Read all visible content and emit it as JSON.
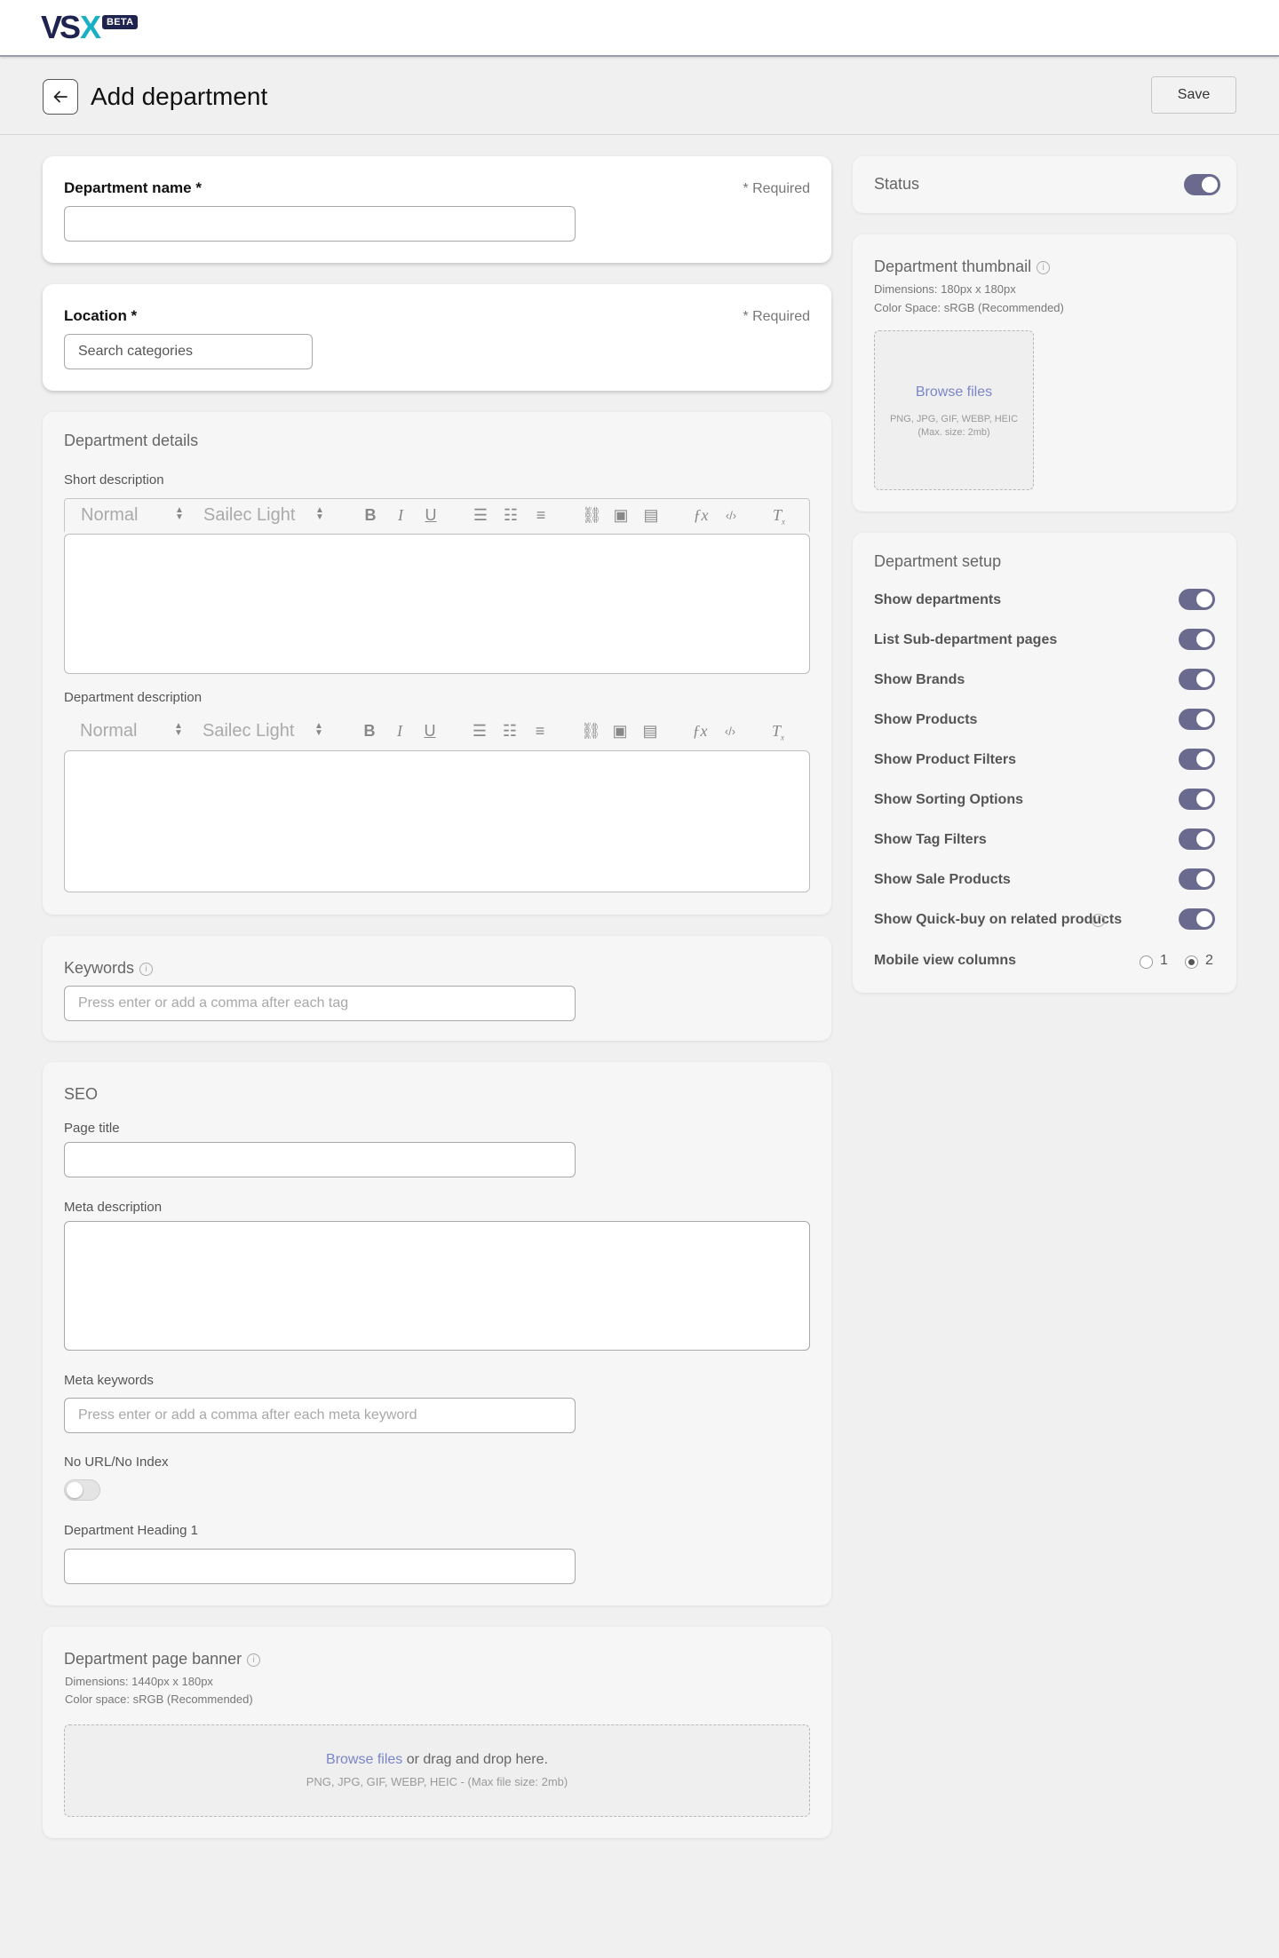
{
  "brand": {
    "logo_vs": "VS",
    "logo_x": "X",
    "badge": "BETA"
  },
  "header": {
    "title": "Add department",
    "save_label": "Save"
  },
  "department_name": {
    "label": "Department name *",
    "required": "* Required",
    "value": ""
  },
  "location": {
    "label": "Location *",
    "required": "* Required",
    "placeholder": "Search categories"
  },
  "details": {
    "title": "Department details",
    "short_label": "Short description",
    "desc_label": "Department description",
    "toolbar": {
      "format": "Normal",
      "font": "Sailec Light"
    }
  },
  "keywords": {
    "label": "Keywords",
    "placeholder": "Press enter or add a comma after each tag"
  },
  "seo": {
    "title": "SEO",
    "page_title_label": "Page title",
    "meta_desc_label": "Meta description",
    "meta_keywords_label": "Meta keywords",
    "meta_keywords_placeholder": "Press enter or add a comma after each meta keyword",
    "noindex_label": "No URL/No Index",
    "noindex_on": false,
    "heading_label": "Department Heading 1"
  },
  "banner": {
    "title": "Department page banner",
    "dims": "Dimensions: 1440px x 180px",
    "color_space": "Color space: sRGB (Recommended)",
    "browse": "Browse files",
    "drag_text": " or drag and drop here.",
    "formats": "PNG, JPG, GIF, WEBP, HEIC - (Max file size: 2mb)"
  },
  "status": {
    "label": "Status",
    "on": true
  },
  "thumbnail": {
    "title": "Department thumbnail",
    "dims": "Dimensions: 180px x 180px",
    "color_space": "Color Space: sRGB (Recommended)",
    "browse": "Browse files",
    "formats": "PNG, JPG, GIF, WEBP, HEIC",
    "max_size": "(Max. size: 2mb)"
  },
  "setup": {
    "title": "Department setup",
    "items": [
      {
        "label": "Show departments",
        "on": true
      },
      {
        "label": "List Sub-department pages",
        "on": true
      },
      {
        "label": "Show Brands",
        "on": true
      },
      {
        "label": "Show Products",
        "on": true
      },
      {
        "label": "Show Product Filters",
        "on": true
      },
      {
        "label": "Show Sorting Options",
        "on": true
      },
      {
        "label": "Show Tag Filters",
        "on": true
      },
      {
        "label": "Show Sale Products",
        "on": true
      },
      {
        "label": "Show Quick-buy on related products",
        "on": true
      }
    ],
    "mobile_label": "Mobile view columns",
    "mobile_options": [
      "1",
      "2"
    ],
    "mobile_selected": "2"
  },
  "colors": {
    "accent_toggle": "#6a6a8e",
    "link": "#7b86c9",
    "logo_navy": "#1f2350",
    "logo_teal": "#1ab0c4"
  }
}
